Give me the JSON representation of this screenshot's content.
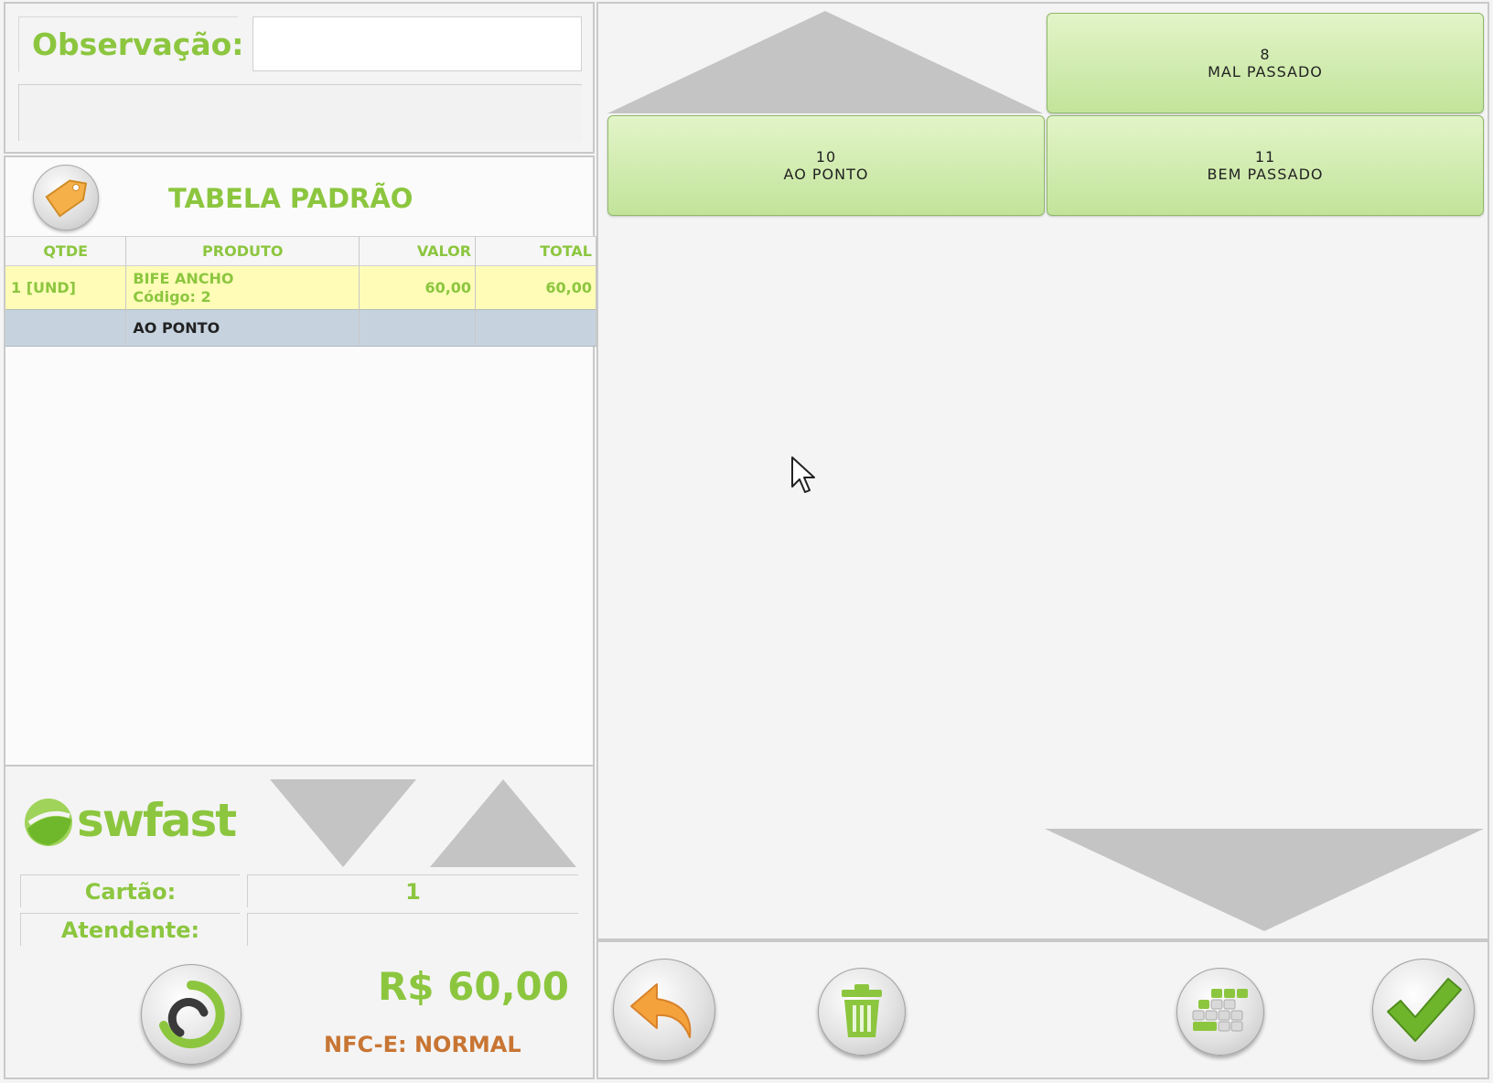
{
  "observacao": {
    "label": "Observação:",
    "value": ""
  },
  "price_table": {
    "title": "TABELA PADRÃO",
    "icon": "price-tag-icon"
  },
  "items_table": {
    "headers": [
      "QTDE",
      "PRODUTO",
      "VALOR",
      "TOTAL"
    ],
    "item": {
      "qty": "1 [UND]",
      "product": "BIFE ANCHO",
      "code": "Código: 2",
      "value": "60,00",
      "total": "60,00"
    },
    "modifier": {
      "name": "AO PONTO"
    }
  },
  "brand": {
    "name": "swfast"
  },
  "info": {
    "card_label": "Cartão:",
    "card_value": "1",
    "attendant_label": "Atendente:",
    "attendant_value": ""
  },
  "total": {
    "amount": "R$ 60,00",
    "nfce_status": "NFC-E: NORMAL"
  },
  "options": [
    {
      "code": "8",
      "label": "MAL PASSADO"
    },
    {
      "code": "10",
      "label": "AO PONTO"
    },
    {
      "code": "11",
      "label": "BEM PASSADO"
    }
  ],
  "colors": {
    "accent_green": "#8cc63f",
    "item_row": "#fefcb7",
    "modifier_row": "#c6d3df",
    "nfce_orange": "#c87533"
  },
  "actions": [
    "back-arrow-icon",
    "trash-icon",
    "keypad-icon",
    "checkmark-icon"
  ]
}
